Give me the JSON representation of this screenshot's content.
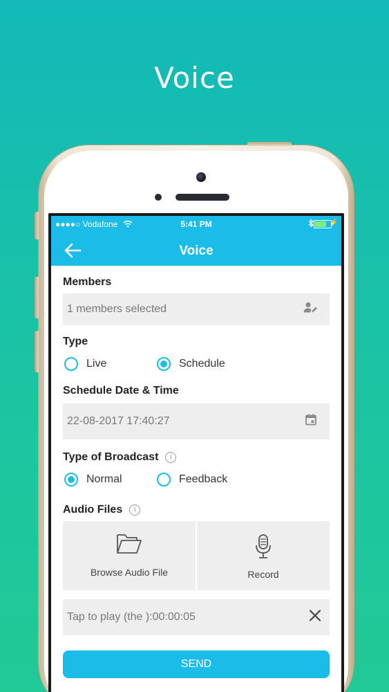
{
  "hero": {
    "title": "Voice"
  },
  "status_bar": {
    "carrier": "●●●●○ Vodafone",
    "time": "5:41 PM",
    "battery_level": 0.8
  },
  "app_bar": {
    "title": "Voice",
    "back_icon": "arrow-left-icon",
    "color": "#1bbde8"
  },
  "members": {
    "label": "Members",
    "value": "1 members selected",
    "icon": "person-edit-icon"
  },
  "type": {
    "label": "Type",
    "options": [
      {
        "label": "Live",
        "checked": false
      },
      {
        "label": "Schedule",
        "checked": true
      }
    ]
  },
  "schedule": {
    "label": "Schedule Date & Time",
    "value": "22-08-2017 17:40:27",
    "icon": "calendar-icon"
  },
  "broadcast": {
    "label": "Type of Broadcast",
    "info_icon": "i",
    "options": [
      {
        "label": "Normal",
        "checked": true
      },
      {
        "label": "Feedback",
        "checked": false
      }
    ]
  },
  "audio": {
    "label": "Audio Files",
    "info_icon": "i",
    "browse_label": "Browse Audio File",
    "record_label": "Record",
    "playback_text": "Tap to play (the ):00:00:05"
  },
  "send": {
    "label": "SEND"
  }
}
